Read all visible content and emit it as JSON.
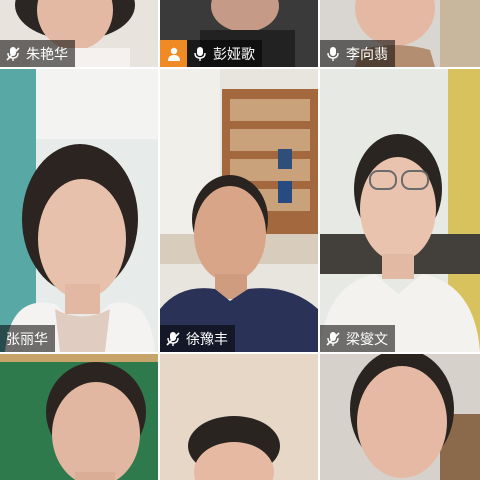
{
  "participants": [
    {
      "name": "朱艳华",
      "mic": "muted"
    },
    {
      "name": "彭娅歌",
      "mic": "on",
      "badge": "person-icon"
    },
    {
      "name": "李向翡",
      "mic": "on"
    },
    {
      "name": "张丽华",
      "mic": "none"
    },
    {
      "name": "徐豫丰",
      "mic": "muted"
    },
    {
      "name": "梁燮文",
      "mic": "muted"
    },
    {
      "name": "",
      "mic": "none"
    },
    {
      "name": "",
      "mic": "none"
    },
    {
      "name": "",
      "mic": "none"
    }
  ],
  "colors": {
    "badge": "#f08a24",
    "label_bg": "rgba(0,0,0,0.55)",
    "label_text": "#ffffff"
  }
}
